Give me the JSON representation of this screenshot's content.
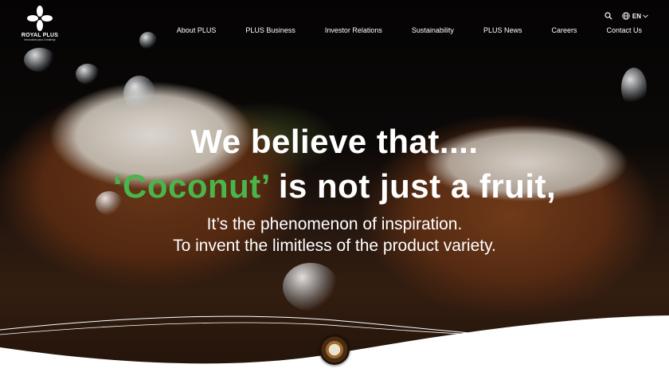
{
  "brand": {
    "name": "ROYAL PLUS",
    "tagline": "Innovation plus Creativity"
  },
  "nav": {
    "items": [
      {
        "label": "About PLUS"
      },
      {
        "label": "PLUS Business"
      },
      {
        "label": "Investor Relations"
      },
      {
        "label": "Sustainability"
      },
      {
        "label": "PLUS News"
      },
      {
        "label": "Careers"
      },
      {
        "label": "Contact Us"
      }
    ]
  },
  "utils": {
    "search_icon": "search-icon",
    "globe_icon": "globe-icon",
    "language": "EN",
    "chevron_icon": "chevron-down-icon"
  },
  "hero": {
    "line1": "We believe that....",
    "line2_highlight": "‘Coconut’",
    "line2_rest": " is not just a fruit,",
    "sub1": "It’s the phenomenon of inspiration.",
    "sub2": "To invent the limitless of the product variety."
  },
  "colors": {
    "accent_green": "#4bb44b",
    "text_white": "#ffffff",
    "wave_white": "#ffffff"
  }
}
